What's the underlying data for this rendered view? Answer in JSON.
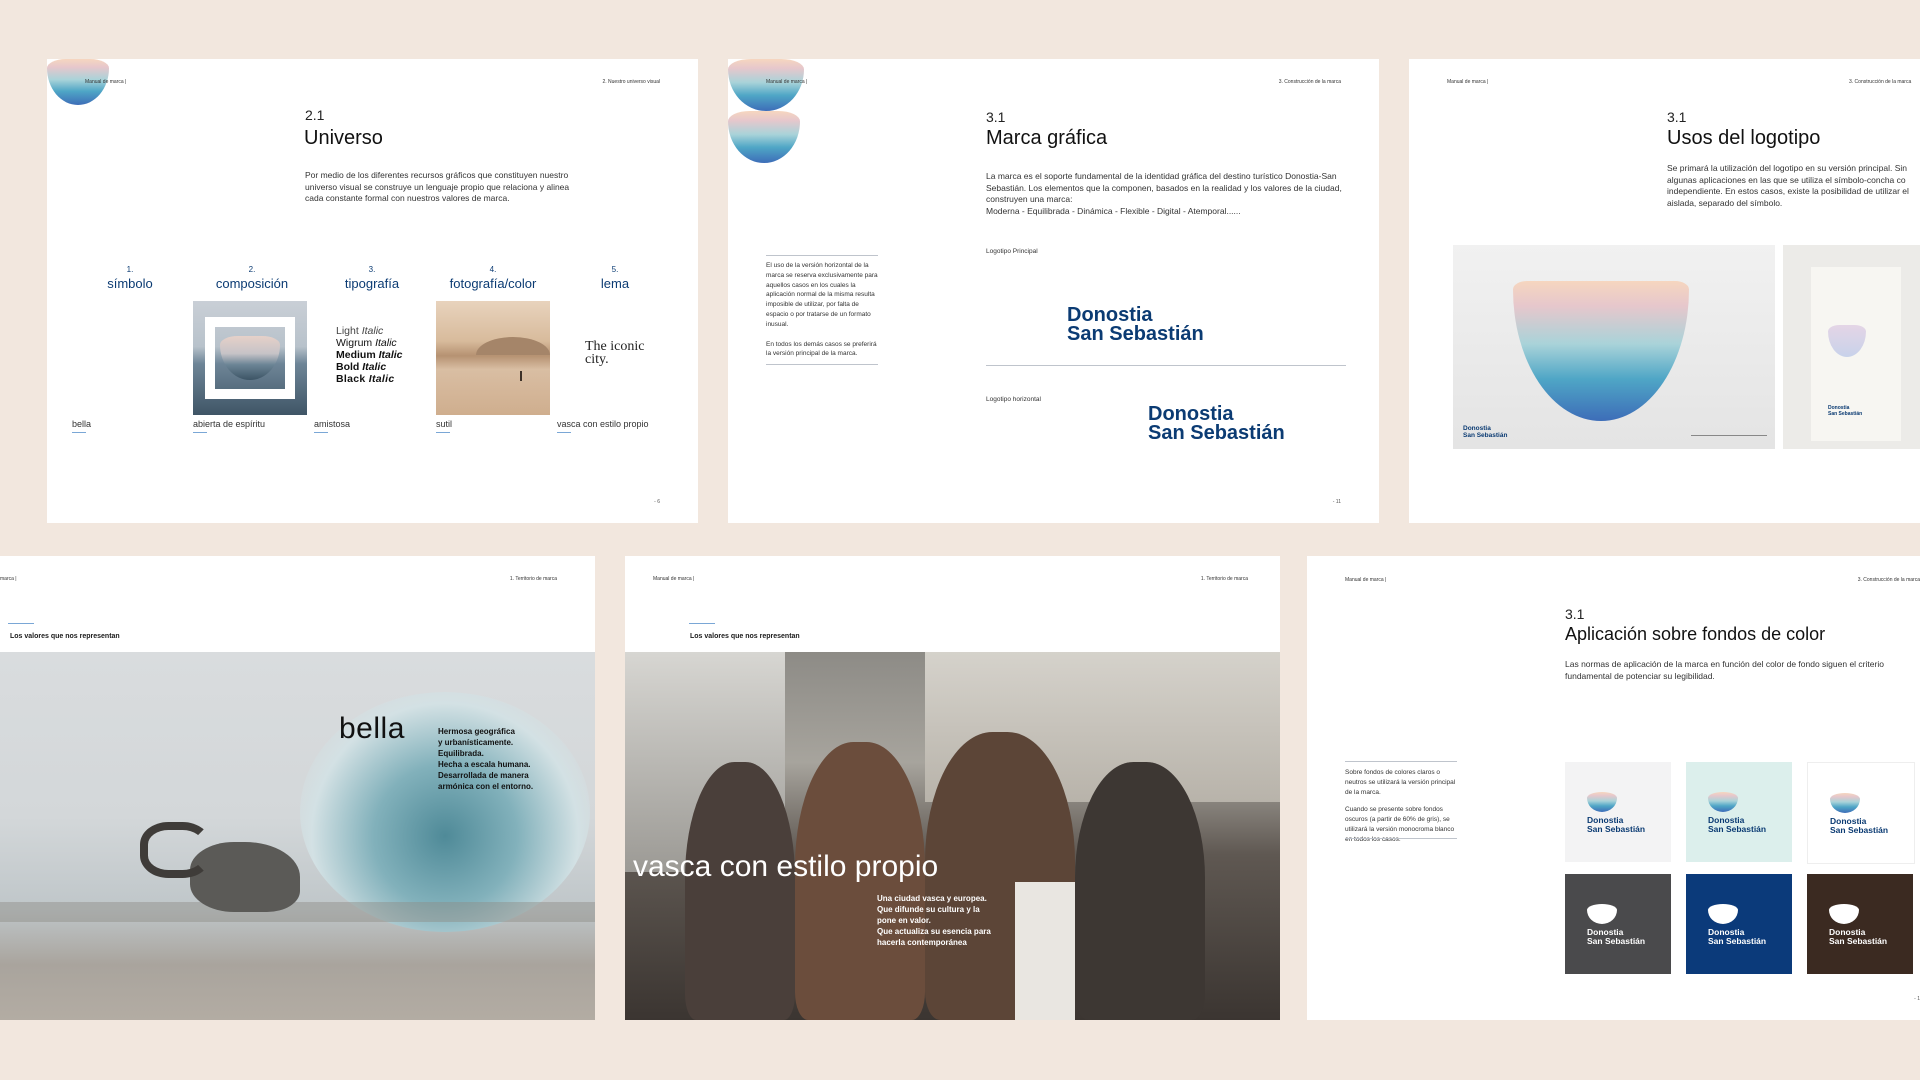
{
  "page1": {
    "header_left": "Manual de marca |",
    "header_right": "2. Nuestro universo visual",
    "number": "2.1",
    "title": "Universo",
    "intro": "Por medio de los diferentes recursos gráficos que constituyen nuestro universo visual se construye un lenguaje propio que relaciona y alinea cada constante formal con nuestros valores de marca.",
    "columns": [
      {
        "num": "1.",
        "label": "símbolo",
        "caption": "bella"
      },
      {
        "num": "2.",
        "label": "composición",
        "caption": "abierta de espíritu"
      },
      {
        "num": "3.",
        "label": "tipografía",
        "caption": "amistosa"
      },
      {
        "num": "4.",
        "label": "fotografía/color",
        "caption": "sutil"
      },
      {
        "num": "5.",
        "label": "lema",
        "caption": "vasca con estilo propio"
      }
    ],
    "type_sample": {
      "light": "Light",
      "light_i": "Italic",
      "wigrum": "Wigrum",
      "wigrum_i": "Italic",
      "medium": "Medium",
      "medium_i": "Italic",
      "bold": "Bold",
      "bold_i": "Italic",
      "black": "Black",
      "black_i": "Italic"
    },
    "slogan_line1": "The iconic",
    "slogan_line2": "city.",
    "page_number": "- 6"
  },
  "page2": {
    "header_left": "Manual de marca |",
    "header_right": "3. Construcción de la marca",
    "number": "3.1",
    "title": "Marca gráfica",
    "intro": "La marca es el soporte fundamental de la identidad gráfica del destino turístico Donostia-San Sebastián. Los elementos que la componen, basados en la realidad y los valores de la ciudad, construyen una marca:",
    "values_line": "Moderna - Equilibrada - Dinámica - Flexible - Digital - Atemporal......",
    "side_note_1": "El uso de la versión horizontal de la marca se reserva exclusivamente para aquellos casos en los cuales la aplicación normal de la misma resulta imposible de utilizar, por falta de espacio o por tratarse de un formato inusual.",
    "side_note_2": "En todos los demás casos se preferirá la versión principal de la marca.",
    "label_principal": "Logotipo Principal",
    "label_horizontal": "Logotipo horizontal",
    "logo_line1": "Donostia",
    "logo_line2": "San Sebastián",
    "page_number": "- 11"
  },
  "page3": {
    "header_left": "Manual de marca |",
    "header_right": "3. Construcción de la marca",
    "number": "3.1",
    "title": "Usos del logotipo",
    "intro": "Se primará la utilización del logotipo en su versión principal. Sin algunas aplicaciones en las que se utiliza el símbolo-concha co independiente. En estos casos, existe la posibilidad de utilizar el aislada, separado del símbolo.",
    "card_line1": "Donostia",
    "card_line2": "San Sebastián",
    "bag_line1": "Donostia",
    "bag_line2": "San Sebastián"
  },
  "page4": {
    "header_left": "marca |",
    "header_right": "1. Territorio de marca",
    "section": "Los valores que nos representan",
    "word": "bella",
    "desc_lines": [
      "Hermosa geográfica",
      "y urbanísticamente.",
      "Equilibrada.",
      "Hecha a escala humana.",
      "Desarrollada de manera",
      "armónica con el entorno."
    ]
  },
  "page5": {
    "header_left": "Manual de marca |",
    "header_right": "1. Territorio de marca",
    "section": "Los valores que nos representan",
    "headline": "vasca con estilo propio",
    "desc_lines": [
      "Una ciudad vasca y europea.",
      "Que difunde su cultura y la",
      "pone en valor.",
      "Que actualiza su esencia para",
      "hacerla contemporánea"
    ]
  },
  "page6": {
    "header_left": "Manual de marca |",
    "header_right": "3. Construcción de la marca",
    "number": "3.1",
    "title": "Aplicación sobre fondos de color",
    "intro": "Las normas de aplicación de la marca en función del color de fondo siguen el criterio fundamental de potenciar su legibilidad.",
    "side_note_1": "Sobre fondos de colores claros o neutros se utilizará la versión principal de la marca.",
    "side_note_2": "Cuando se presente sobre fondos oscuros (a partir de 60% de gris), se utilizará la versión monocroma blanco en todos los casos.",
    "swatch_line1": "Donostia",
    "swatch_line2": "San Sebastián",
    "swatches": [
      {
        "bg": "#f3f3f4",
        "text": "#0b3b73"
      },
      {
        "bg": "#dcefec",
        "text": "#0b3b73"
      },
      {
        "bg": "#ffffff",
        "text": "#0b3b73"
      },
      {
        "bg": "#4a4a4c",
        "text": "#ffffff"
      },
      {
        "bg": "#0b3a7a",
        "text": "#ffffff"
      },
      {
        "bg": "#3b2a21",
        "text": "#ffffff"
      }
    ],
    "page_number": "- 1"
  },
  "colors": {
    "brand_blue": "#0b3b73",
    "background": "#f2e7de"
  }
}
